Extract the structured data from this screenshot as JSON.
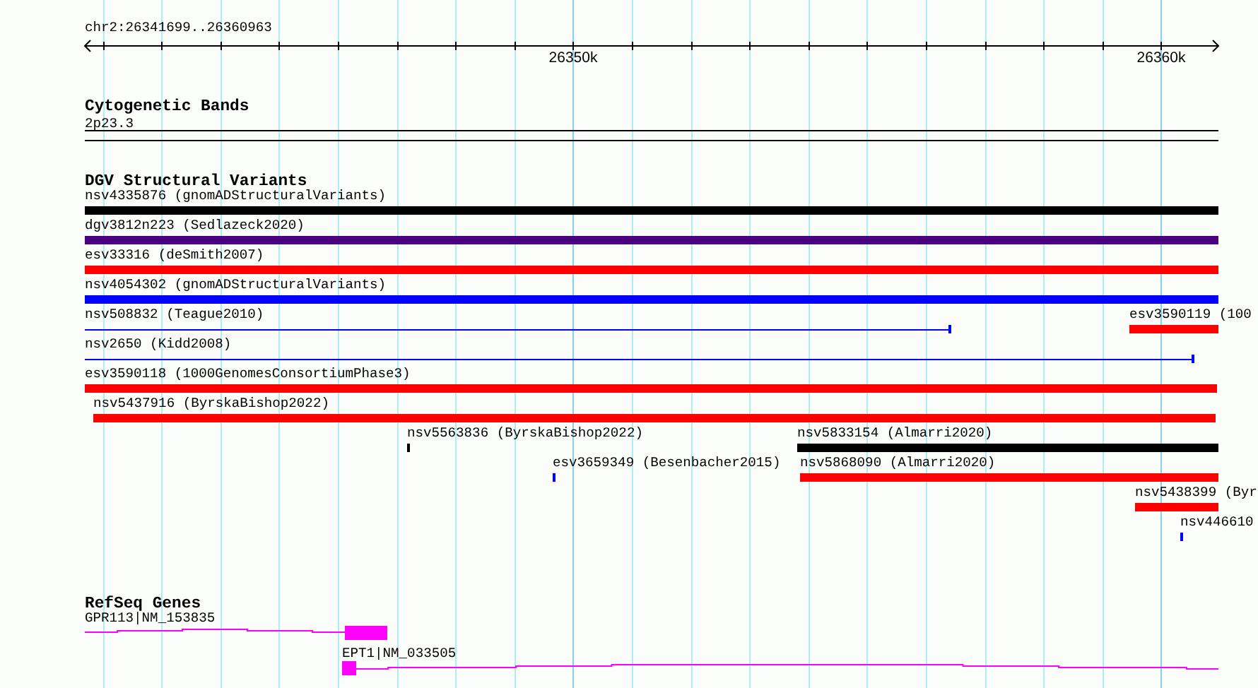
{
  "ruler": {
    "location": "chr2:26341699..26360963",
    "ticks": [
      {
        "label": "26350k"
      },
      {
        "label": "26360k"
      }
    ]
  },
  "tracks": [
    {
      "kind": "bands",
      "title": "Cytogenetic Bands",
      "features": [
        {
          "label": "2p23.3"
        }
      ]
    },
    {
      "kind": "variants",
      "title": "DGV Structural Variants",
      "rows": [
        {
          "features": [
            {
              "label": "nsv4335876 (gnomADStructuralVariants)",
              "kind": "thick",
              "color": "#000000"
            }
          ]
        },
        {
          "features": [
            {
              "label": "dgv3812n223 (Sedlazeck2020)",
              "kind": "thick",
              "color": "#4b0082"
            }
          ]
        },
        {
          "features": [
            {
              "label": "esv33316 (deSmith2007)",
              "kind": "thick",
              "color": "#ff0000"
            }
          ]
        },
        {
          "features": [
            {
              "label": "nsv4054302 (gnomADStructuralVariants)",
              "kind": "thick",
              "color": "#0000ff"
            }
          ]
        },
        {
          "features": [
            {
              "label": "nsv508832 (Teague2010)",
              "kind": "thin",
              "color": "#0000ff"
            },
            {
              "label": "esv3590119 (100",
              "kind": "thick",
              "color": "#ff0000"
            }
          ]
        },
        {
          "features": [
            {
              "label": "nsv2650 (Kidd2008)",
              "kind": "thin",
              "color": "#0000ff"
            }
          ]
        },
        {
          "features": [
            {
              "label": "esv3590118 (1000GenomesConsortiumPhase3)",
              "kind": "thick",
              "color": "#ff0000"
            }
          ]
        },
        {
          "features": [
            {
              "label": "nsv5437916 (ByrskaBishop2022)",
              "kind": "thick",
              "color": "#ff0000"
            }
          ]
        },
        {
          "features": [
            {
              "label": "nsv5563836 (ByrskaBishop2022)",
              "kind": "mark",
              "color": "#000000"
            },
            {
              "label": "nsv5833154 (Almarri2020)",
              "kind": "thick",
              "color": "#000000"
            }
          ]
        },
        {
          "features": [
            {
              "label": "esv3659349 (Besenbacher2015)",
              "kind": "mark",
              "color": "#0000ff"
            },
            {
              "label": "nsv5868090 (Almarri2020)",
              "kind": "thick",
              "color": "#ff0000"
            }
          ]
        },
        {
          "features": [
            {
              "label": "nsv5438399 (Byr",
              "kind": "thick",
              "color": "#ff0000"
            }
          ]
        },
        {
          "features": [
            {
              "label": "nsv446610",
              "kind": "mark",
              "color": "#0000ff"
            }
          ]
        }
      ]
    },
    {
      "kind": "genes",
      "title": "RefSeq Genes",
      "genes": [
        {
          "label": "GPR113|NM_153835"
        },
        {
          "label": "EPT1|NM_033505"
        }
      ]
    }
  ]
}
